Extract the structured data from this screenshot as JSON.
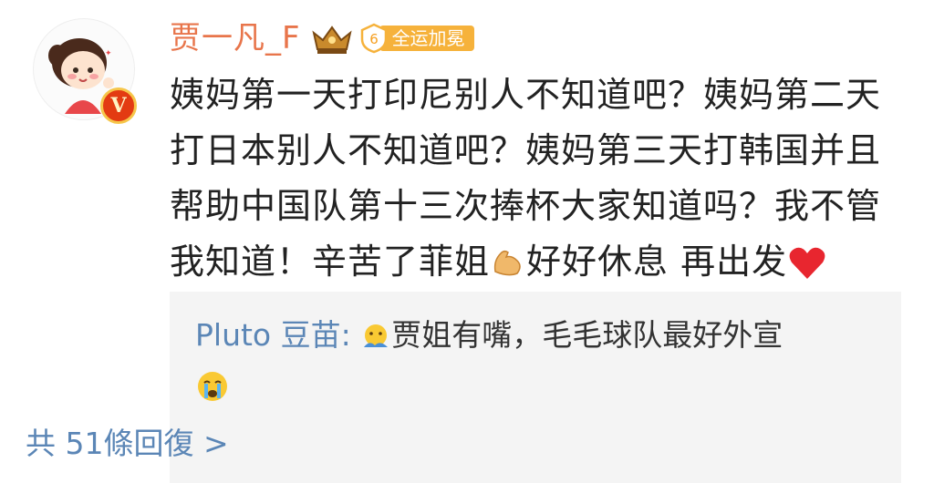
{
  "post": {
    "username": "贾一凡_F",
    "badge_level": "6",
    "badge_label": "全运加冕",
    "text_part1": "姨妈第一天打印尼别人不知道吧？姨妈第二天打日本别人不知道吧？姨妈第三天打韩国并且帮助中国队第十三次捧杯大家知道吗？我不管我知道！辛苦了菲姐",
    "text_part2": "好好休息 再出发",
    "icons": [
      "crown-icon",
      "level-shield-icon",
      "muscle-emoji",
      "heart-emoji"
    ],
    "colors": {
      "username": "#e8754b",
      "badge": "#f6b23b",
      "link": "#5b86b6",
      "heart": "#e8262f"
    }
  },
  "comment": {
    "author": "Pluto 豆苗",
    "separator": ":",
    "text": "贾姐有嘴，毛毛球队最好外宣",
    "icons": [
      "hug-emoji",
      "crying-emoji"
    ],
    "reply_link": "共 51條回復 >"
  }
}
